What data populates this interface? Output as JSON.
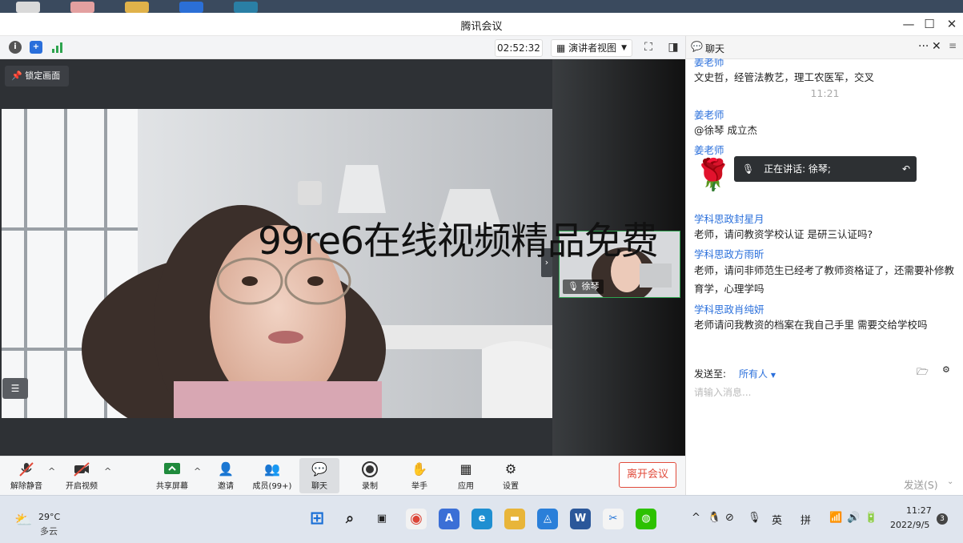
{
  "window": {
    "title": "腾讯会议"
  },
  "meeting_bar": {
    "timer": "02:52:32",
    "view_mode": "演讲者视图",
    "chat_tab": "聊天"
  },
  "stage": {
    "lock_button": "锁定画面",
    "thumbnail_name": "徐琴",
    "speaking_label": "正在讲话: 徐琴;"
  },
  "controls": {
    "unmute": "解除静音",
    "start_video": "开启视频",
    "share_screen": "共享屏幕",
    "invite": "邀请",
    "members": "成员(99+)",
    "chat": "聊天",
    "record": "录制",
    "raise_hand": "举手",
    "apps": "应用",
    "settings": "设置",
    "leave": "离开会议"
  },
  "chat": {
    "messages": [
      {
        "sender": "姜老师",
        "text": "文史哲，经管法教艺，理工农医军，交叉"
      },
      {
        "time": "11:21"
      },
      {
        "sender": "姜老师",
        "text": "@徐琴 成立杰"
      },
      {
        "sender": "姜老师",
        "text": "🌹"
      },
      {
        "sender": "学科思政封星月",
        "text": "老师，请问教资学校认证 是研三认证吗?"
      },
      {
        "sender": "学科思政方雨昕",
        "text": "老师，请问非师范生已经考了教师资格证了，还需要补修教育学，心理学吗"
      },
      {
        "sender": "学科思政肖纯妍",
        "text": "老师请问我教资的档案在我自己手里 需要交给学校吗"
      }
    ],
    "send_to_label": "发送至:",
    "send_to_value": "所有人",
    "input_placeholder": "请输入消息...",
    "send_button": "发送(S)"
  },
  "watermark": "99re6在线视频精品免费",
  "taskbar": {
    "weather_temp": "29°C",
    "weather_desc": "多云",
    "ime_lang": "英",
    "ime_mode": "拼",
    "time": "11:27",
    "date": "2022/9/5",
    "notifications": "3"
  },
  "colors": {
    "accent_blue": "#2a6fdb",
    "leave_red": "#e14b3b",
    "active_green": "#2ea44f"
  }
}
